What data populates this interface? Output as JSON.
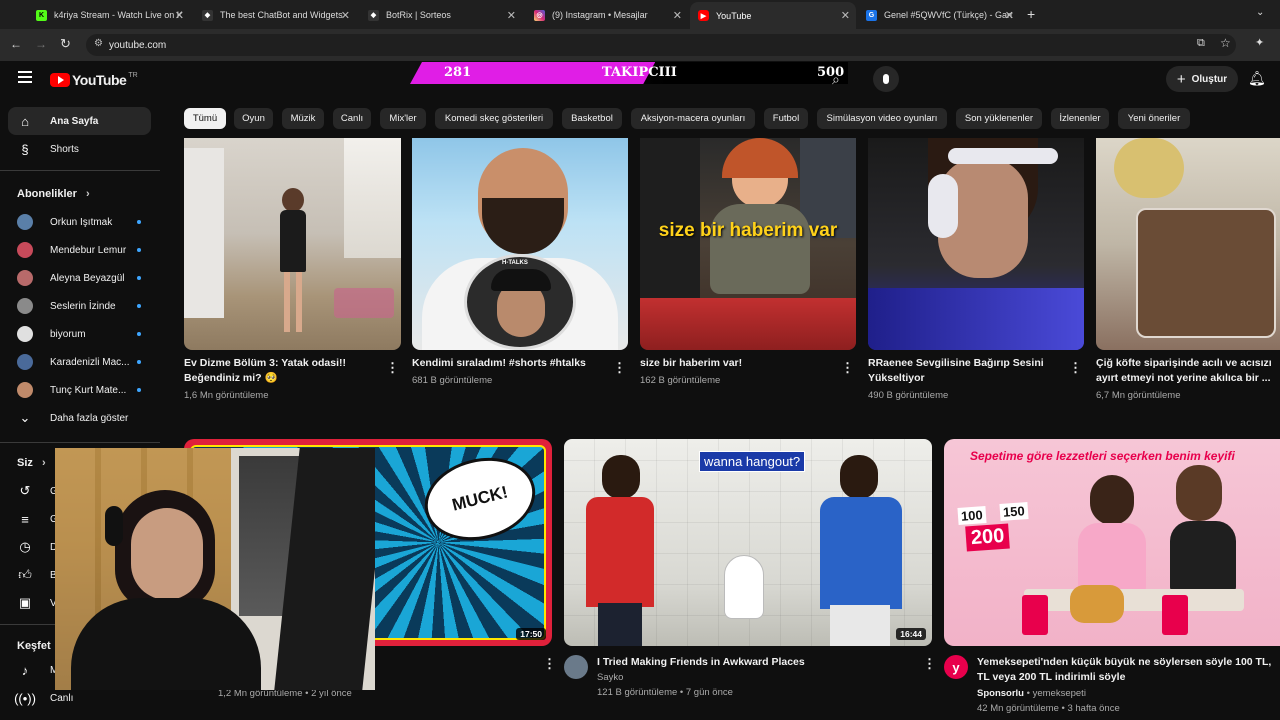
{
  "browser": {
    "tabs": [
      {
        "title": "k4riya Stream - Watch Live on K",
        "color": "#53fc18",
        "glyph": "K"
      },
      {
        "title": "The best ChatBot and Widgets",
        "color": "#555555",
        "glyph": "◆"
      },
      {
        "title": "BotRix | Sorteos",
        "color": "#555555",
        "glyph": "◆"
      },
      {
        "title": "(9) Instagram • Mesajlar",
        "color": "#d62976",
        "glyph": "◎"
      },
      {
        "title": "YouTube",
        "color": "#ff0000",
        "glyph": "▶"
      },
      {
        "title": "Genel #5QWVfC (Türkçe) - Gart",
        "color": "#1a73e8",
        "glyph": "G"
      }
    ],
    "url": "youtube.com"
  },
  "header": {
    "logo_text": "YouTube",
    "region": "TR",
    "create_label": "Oluştur"
  },
  "overlay": {
    "left_count": "281",
    "label": "TAKIPCIII",
    "right_count": "500",
    "progress": 0.56
  },
  "sidebar": {
    "main": [
      {
        "label": "Ana Sayfa",
        "icon": "home-icon"
      },
      {
        "label": "Shorts",
        "icon": "shorts-icon"
      }
    ],
    "subs_header": "Abonelikler",
    "subscriptions": [
      {
        "name": "Orkun Işıtmak",
        "color": "#5a7fa8"
      },
      {
        "name": "Mendebur Lemur",
        "color": "#c74a5a"
      },
      {
        "name": "Aleyna Beyazgül",
        "color": "#b86a6a"
      },
      {
        "name": "Seslerin İzinde",
        "color": "#8a8a8a"
      },
      {
        "name": "biyorum",
        "color": "#e0e0e0"
      },
      {
        "name": "Karadenizli Mac...",
        "color": "#4a6a9a"
      },
      {
        "name": "Tunç Kurt Mate...",
        "color": "#c08a6a"
      }
    ],
    "show_more": "Daha fazla göster",
    "you_header": "Siz",
    "you_items": [
      "G",
      "G",
      "D",
      "B",
      "V"
    ],
    "explore_header": "Keşfet",
    "explore_items": [
      "M",
      "Canlı"
    ]
  },
  "chips": [
    "Tümü",
    "Oyun",
    "Müzik",
    "Canlı",
    "Mix'ler",
    "Komedi skeç gösterileri",
    "Basketbol",
    "Aksiyon-macera oyunları",
    "Futbol",
    "Simülasyon video oyunları",
    "Son yüklenenler",
    "İzlenenler",
    "Yeni öneriler"
  ],
  "row1": [
    {
      "title_line1": "Ev Dizme Bölüm 3: Yatak odasi!!",
      "title_line2": "Beğendiniz mi? 🥺",
      "meta": "1,6 Mn görüntüleme"
    },
    {
      "title_line1": "Kendimi sıraladım! #shorts #htalks",
      "title_line2": "",
      "meta": "681 B görüntüleme",
      "badge": "H-TALKS"
    },
    {
      "title_line1": "size bir haberim var!",
      "title_line2": "",
      "meta": "162 B görüntüleme",
      "overlay_text": "size bir haberim var"
    },
    {
      "title_line1": "RRaenee Sevgilisine Bağırıp Sesini",
      "title_line2": "Yükseltiyor",
      "meta": "490 B görüntüleme"
    },
    {
      "title_line1": "Çiğ köfte siparişinde acılı ve acısızı",
      "title_line2": "ayırt etmeyi not yerine akılıca bir ...",
      "meta": "6,7 Mn görüntüleme"
    }
  ],
  "row2": [
    {
      "duration": "17:50",
      "bubble": "MUCK!",
      "meta": "1,2 Mn görüntüleme • 2 yıl önce"
    },
    {
      "duration": "16:44",
      "caption": "wanna hangout?",
      "title": "I Tried Making Friends in Awkward Places",
      "channel": "Sayko",
      "meta": "121 B görüntüleme • 7 gün önce"
    },
    {
      "banner": "Sepetime göre lezzetleri seçerken benim keyifi",
      "prices": [
        "100",
        "150",
        "200"
      ],
      "title_line1": "Yemeksepeti'nden küçük büyük ne söylersen söyle 100 TL,",
      "title_line2": "TL veya 200 TL indirimli söyle",
      "sponsor": "Sponsorlu",
      "channel": "yemeksepeti",
      "meta": "42 Mn görüntüleme • 3 hafta önce"
    }
  ]
}
